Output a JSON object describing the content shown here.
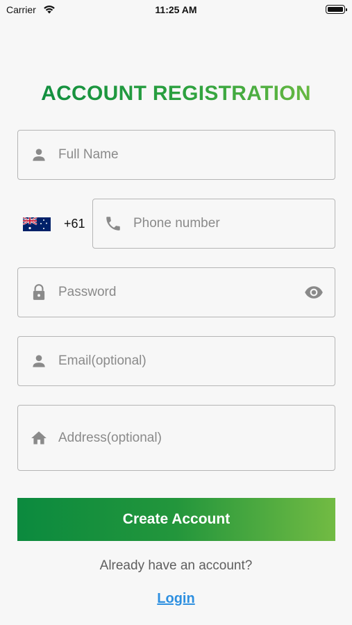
{
  "status_bar": {
    "carrier": "Carrier",
    "time": "11:25 AM"
  },
  "title": "ACCOUNT REGISTRATION",
  "fields": {
    "full_name": {
      "placeholder": "Full Name",
      "icon": "person-icon"
    },
    "phone": {
      "country_flag": "australia-flag-icon",
      "dial_code": "+61",
      "placeholder": "Phone number",
      "icon": "phone-icon"
    },
    "password": {
      "placeholder": "Password",
      "icon": "lock-icon",
      "toggle_icon": "eye-icon"
    },
    "email": {
      "placeholder": "Email(optional)",
      "icon": "person-icon"
    },
    "address": {
      "placeholder": "Address(optional)",
      "icon": "home-icon"
    }
  },
  "actions": {
    "create_account_label": "Create Account",
    "already_have_account": "Already have an account?",
    "login_label": "Login"
  },
  "colors": {
    "title_gradient": [
      "#0a8a3f",
      "#7cc043"
    ],
    "button_gradient": [
      "#0b8a3e",
      "#72bb43"
    ],
    "link": "#2d8fe0",
    "placeholder": "#8a8a8a",
    "border": "#b5b5b5"
  }
}
